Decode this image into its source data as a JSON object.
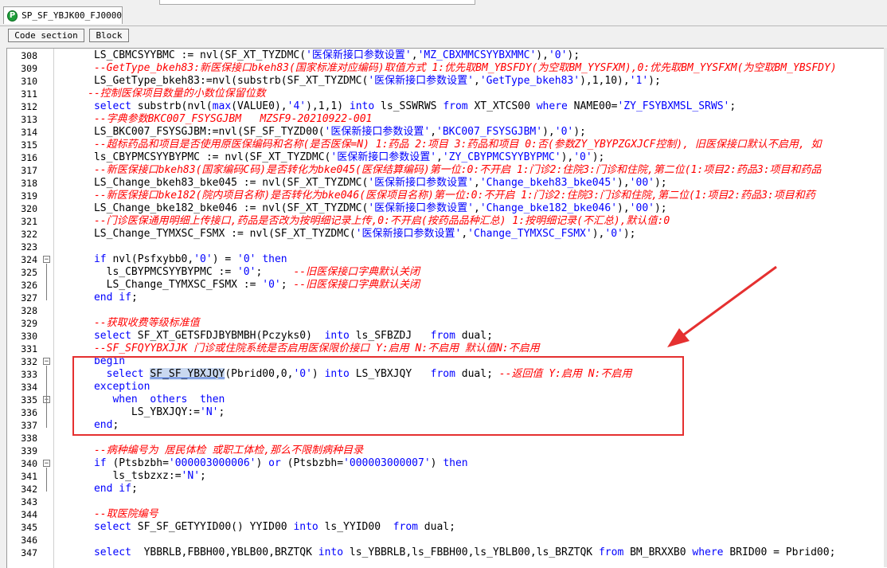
{
  "document_tab": {
    "icon": "p-circle-icon",
    "icon_letter": "P",
    "title": "SP_SF_YBJK00_FJ0000"
  },
  "section_buttons": [
    "Code section",
    "Block"
  ],
  "colors": {
    "keyword": "#0000ff",
    "comment": "#ff0000",
    "annotation": "#e53030",
    "icon": "#1e9e3a"
  },
  "lines": [
    {
      "n": "308",
      "segs": [
        [
          "p",
          "      LS_CBMCSYYBMC := nvl(SF_XT_TYZDMC("
        ],
        [
          "s",
          "'医保新接口参数设置'"
        ],
        [
          "p",
          ","
        ],
        [
          "s",
          "'MZ_CBXMMCSYYBXMMC'"
        ],
        [
          "p",
          "),"
        ],
        [
          "s",
          "'0'"
        ],
        [
          "p",
          ");"
        ]
      ]
    },
    {
      "n": "309",
      "segs": [
        [
          "p",
          "      "
        ],
        [
          "c",
          "--GetType_bkeh83:新医保接口bkeh83(国家标准对应编码)取值方式 1:优先取BM_YBSFDY(为空取BM_YYSFXM),0:优先取BM_YYSFXM(为空取BM_YBSFDY)"
        ]
      ]
    },
    {
      "n": "310",
      "segs": [
        [
          "p",
          "      LS_GetType_bkeh83:=nvl(substrb(SF_XT_TYZDMC("
        ],
        [
          "s",
          "'医保新接口参数设置'"
        ],
        [
          "p",
          ","
        ],
        [
          "s",
          "'GetType_bkeh83'"
        ],
        [
          "p",
          "),1,10),"
        ],
        [
          "s",
          "'1'"
        ],
        [
          "p",
          ");"
        ]
      ]
    },
    {
      "n": "311",
      "segs": [
        [
          "p",
          "     "
        ],
        [
          "c",
          "--控制医保项目数量的小数位保留位数"
        ]
      ]
    },
    {
      "n": "312",
      "segs": [
        [
          "p",
          "      "
        ],
        [
          "k",
          "select"
        ],
        [
          "p",
          " substrb(nvl("
        ],
        [
          "k",
          "max"
        ],
        [
          "p",
          "(VALUE0),"
        ],
        [
          "s",
          "'4'"
        ],
        [
          "p",
          "),1,1) "
        ],
        [
          "k",
          "into"
        ],
        [
          "p",
          " ls_SSWRWS "
        ],
        [
          "k",
          "from"
        ],
        [
          "p",
          " XT_XTCS00 "
        ],
        [
          "k",
          "where"
        ],
        [
          "p",
          " NAME00="
        ],
        [
          "s",
          "'ZY_FSYBXMSL_SRWS'"
        ],
        [
          "p",
          ";"
        ]
      ]
    },
    {
      "n": "313",
      "segs": [
        [
          "p",
          "      "
        ],
        [
          "c",
          "--字典参数BKC007_FSYSGJBM   MZSF9-20210922-001"
        ]
      ]
    },
    {
      "n": "314",
      "segs": [
        [
          "p",
          "      LS_BKC007_FSYSGJBM:=nvl(SF_SF_TYZD00("
        ],
        [
          "s",
          "'医保新接口参数设置'"
        ],
        [
          "p",
          ","
        ],
        [
          "s",
          "'BKC007_FSYSGJBM'"
        ],
        [
          "p",
          "),"
        ],
        [
          "s",
          "'0'"
        ],
        [
          "p",
          ");"
        ]
      ]
    },
    {
      "n": "315",
      "segs": [
        [
          "p",
          "      "
        ],
        [
          "c",
          "--超标药品和项目是否使用原医保编码和名称(是否医保=N) 1:药品 2:项目 3:药品和项目 0:否(参数ZY_YBYPZGXJCF控制), 旧医保接口默认不启用, 如"
        ]
      ]
    },
    {
      "n": "316",
      "segs": [
        [
          "p",
          "      ls_CBYPMCSYYBYPMC := nvl(SF_XT_TYZDMC("
        ],
        [
          "s",
          "'医保新接口参数设置'"
        ],
        [
          "p",
          ","
        ],
        [
          "s",
          "'ZY_CBYPMCSYYBYPMC'"
        ],
        [
          "p",
          "),"
        ],
        [
          "s",
          "'0'"
        ],
        [
          "p",
          ");"
        ]
      ]
    },
    {
      "n": "317",
      "segs": [
        [
          "p",
          "      "
        ],
        [
          "c",
          "--新医保接口bkeh83(国家编码C码)是否转化为bke045(医保结算编码)第一位:0:不开启 1:门诊2:住院3:门诊和住院,第二位(1:项目2:药品3:项目和药品"
        ]
      ]
    },
    {
      "n": "318",
      "segs": [
        [
          "p",
          "      LS_Change_bkeh83_bke045 := nvl(SF_XT_TYZDMC("
        ],
        [
          "s",
          "'医保新接口参数设置'"
        ],
        [
          "p",
          ","
        ],
        [
          "s",
          "'Change_bkeh83_bke045'"
        ],
        [
          "p",
          "),"
        ],
        [
          "s",
          "'00'"
        ],
        [
          "p",
          ");"
        ]
      ]
    },
    {
      "n": "319",
      "segs": [
        [
          "p",
          "      "
        ],
        [
          "c",
          "--新医保接口bke182(院内项目名称)是否转化为bke046(医保项目名称)第一位:0:不开启 1:门诊2:住院3:门诊和住院,第二位(1:项目2:药品3:项目和药"
        ]
      ]
    },
    {
      "n": "320",
      "segs": [
        [
          "p",
          "      LS_Change_bke182_bke046 := nvl(SF_XT_TYZDMC("
        ],
        [
          "s",
          "'医保新接口参数设置'"
        ],
        [
          "p",
          ","
        ],
        [
          "s",
          "'Change_bke182_bke046'"
        ],
        [
          "p",
          "),"
        ],
        [
          "s",
          "'00'"
        ],
        [
          "p",
          ");"
        ]
      ]
    },
    {
      "n": "321",
      "segs": [
        [
          "p",
          "      "
        ],
        [
          "c",
          "--门诊医保通用明细上传接口,药品是否改为按明细记录上传,0:不开启(按药品品种汇总) 1:按明细记录(不汇总),默认值:0"
        ]
      ]
    },
    {
      "n": "322",
      "segs": [
        [
          "p",
          "      LS_Change_TYMXSC_FSMX := nvl(SF_XT_TYZDMC("
        ],
        [
          "s",
          "'医保新接口参数设置'"
        ],
        [
          "p",
          ","
        ],
        [
          "s",
          "'Change_TYMXSC_FSMX'"
        ],
        [
          "p",
          "),"
        ],
        [
          "s",
          "'0'"
        ],
        [
          "p",
          ");"
        ]
      ]
    },
    {
      "n": "323",
      "segs": []
    },
    {
      "n": "324",
      "fold": "−",
      "segs": [
        [
          "p",
          "      "
        ],
        [
          "k",
          "if"
        ],
        [
          "p",
          " nvl(Psfxybb0,"
        ],
        [
          "s",
          "'0'"
        ],
        [
          "p",
          ") = "
        ],
        [
          "s",
          "'0'"
        ],
        [
          "p",
          " "
        ],
        [
          "k",
          "then"
        ]
      ]
    },
    {
      "n": "325",
      "segs": [
        [
          "p",
          "        ls_CBYPMCSYYBYPMC := "
        ],
        [
          "s",
          "'0'"
        ],
        [
          "p",
          ";     "
        ],
        [
          "c",
          "--旧医保接口字典默认关闭"
        ]
      ]
    },
    {
      "n": "326",
      "segs": [
        [
          "p",
          "        LS_Change_TYMXSC_FSMX := "
        ],
        [
          "s",
          "'0'"
        ],
        [
          "p",
          "; "
        ],
        [
          "c",
          "--旧医保接口字典默认关闭"
        ]
      ]
    },
    {
      "n": "327",
      "segs": [
        [
          "p",
          "      "
        ],
        [
          "k",
          "end if"
        ],
        [
          "p",
          ";"
        ]
      ]
    },
    {
      "n": "328",
      "segs": []
    },
    {
      "n": "329",
      "segs": [
        [
          "p",
          "      "
        ],
        [
          "c",
          "--获取收费等级标准值"
        ]
      ]
    },
    {
      "n": "330",
      "segs": [
        [
          "p",
          "      "
        ],
        [
          "k",
          "select"
        ],
        [
          "p",
          " SF_XT_GETSFDJBYBMBH(Pczyks0)  "
        ],
        [
          "k",
          "into"
        ],
        [
          "p",
          " ls_SFBZDJ   "
        ],
        [
          "k",
          "from"
        ],
        [
          "p",
          " dual;"
        ]
      ]
    },
    {
      "n": "331",
      "segs": [
        [
          "p",
          "      "
        ],
        [
          "c",
          "--SF_SFQYYBXJJK 门诊或住院系统是否启用医保限价接口 Y:启用 N:不启用 默认值N:不启用"
        ]
      ]
    },
    {
      "n": "332",
      "fold": "−",
      "segs": [
        [
          "p",
          "      "
        ],
        [
          "k",
          "begin"
        ]
      ]
    },
    {
      "n": "333",
      "segs": [
        [
          "p",
          "        "
        ],
        [
          "k",
          "select"
        ],
        [
          "p",
          " "
        ],
        [
          "h",
          "SF_SF_YBXJQY"
        ],
        [
          "p",
          "(Pbrid00,0,"
        ],
        [
          "s",
          "'0'"
        ],
        [
          "p",
          ") "
        ],
        [
          "k",
          "into"
        ],
        [
          "p",
          " LS_YBXJQY   "
        ],
        [
          "k",
          "from"
        ],
        [
          "p",
          " dual; "
        ],
        [
          "c",
          "--返回值 Y:启用 N:不启用"
        ]
      ]
    },
    {
      "n": "334",
      "segs": [
        [
          "p",
          "      "
        ],
        [
          "k",
          "exception"
        ]
      ]
    },
    {
      "n": "335",
      "fold": "−",
      "segs": [
        [
          "p",
          "         "
        ],
        [
          "k",
          "when"
        ],
        [
          "p",
          "  "
        ],
        [
          "k",
          "others"
        ],
        [
          "p",
          "  "
        ],
        [
          "k",
          "then"
        ]
      ]
    },
    {
      "n": "336",
      "segs": [
        [
          "p",
          "            LS_YBXJQY:="
        ],
        [
          "s",
          "'N'"
        ],
        [
          "p",
          ";"
        ]
      ]
    },
    {
      "n": "337",
      "segs": [
        [
          "p",
          "      "
        ],
        [
          "k",
          "end"
        ],
        [
          "p",
          ";"
        ]
      ]
    },
    {
      "n": "338",
      "segs": []
    },
    {
      "n": "339",
      "segs": [
        [
          "p",
          "      "
        ],
        [
          "c",
          "--病种编号为 居民体检 或职工体检,那么不限制病种目录"
        ]
      ]
    },
    {
      "n": "340",
      "fold": "−",
      "segs": [
        [
          "p",
          "      "
        ],
        [
          "k",
          "if"
        ],
        [
          "p",
          " (Ptsbzbh="
        ],
        [
          "s",
          "'000003000006'"
        ],
        [
          "p",
          ") "
        ],
        [
          "k",
          "or"
        ],
        [
          "p",
          " (Ptsbzbh="
        ],
        [
          "s",
          "'000003000007'"
        ],
        [
          "p",
          ") "
        ],
        [
          "k",
          "then"
        ]
      ]
    },
    {
      "n": "341",
      "segs": [
        [
          "p",
          "         ls_tsbzxz:="
        ],
        [
          "s",
          "'N'"
        ],
        [
          "p",
          ";"
        ]
      ]
    },
    {
      "n": "342",
      "segs": [
        [
          "p",
          "      "
        ],
        [
          "k",
          "end if"
        ],
        [
          "p",
          ";"
        ]
      ]
    },
    {
      "n": "343",
      "segs": []
    },
    {
      "n": "344",
      "segs": [
        [
          "p",
          "      "
        ],
        [
          "c",
          "--取医院编号"
        ]
      ]
    },
    {
      "n": "345",
      "segs": [
        [
          "p",
          "      "
        ],
        [
          "k",
          "select"
        ],
        [
          "p",
          " SF_SF_GETYYID00() YYID00 "
        ],
        [
          "k",
          "into"
        ],
        [
          "p",
          " ls_YYID00  "
        ],
        [
          "k",
          "from"
        ],
        [
          "p",
          " dual;"
        ]
      ]
    },
    {
      "n": "346",
      "segs": []
    },
    {
      "n": "347",
      "segs": [
        [
          "p",
          "      "
        ],
        [
          "k",
          "select"
        ],
        [
          "p",
          "  YBBRLB,FBBH00,YBLB00,BRZTQK "
        ],
        [
          "k",
          "into"
        ],
        [
          "p",
          " ls_YBBRLB,ls_FBBH00,ls_YBLB00,ls_BRZTQK "
        ],
        [
          "k",
          "from"
        ],
        [
          "p",
          " BM_BRXXB0 "
        ],
        [
          "k",
          "where"
        ],
        [
          "p",
          " BRID00 = Pbrid00;"
        ]
      ]
    }
  ]
}
